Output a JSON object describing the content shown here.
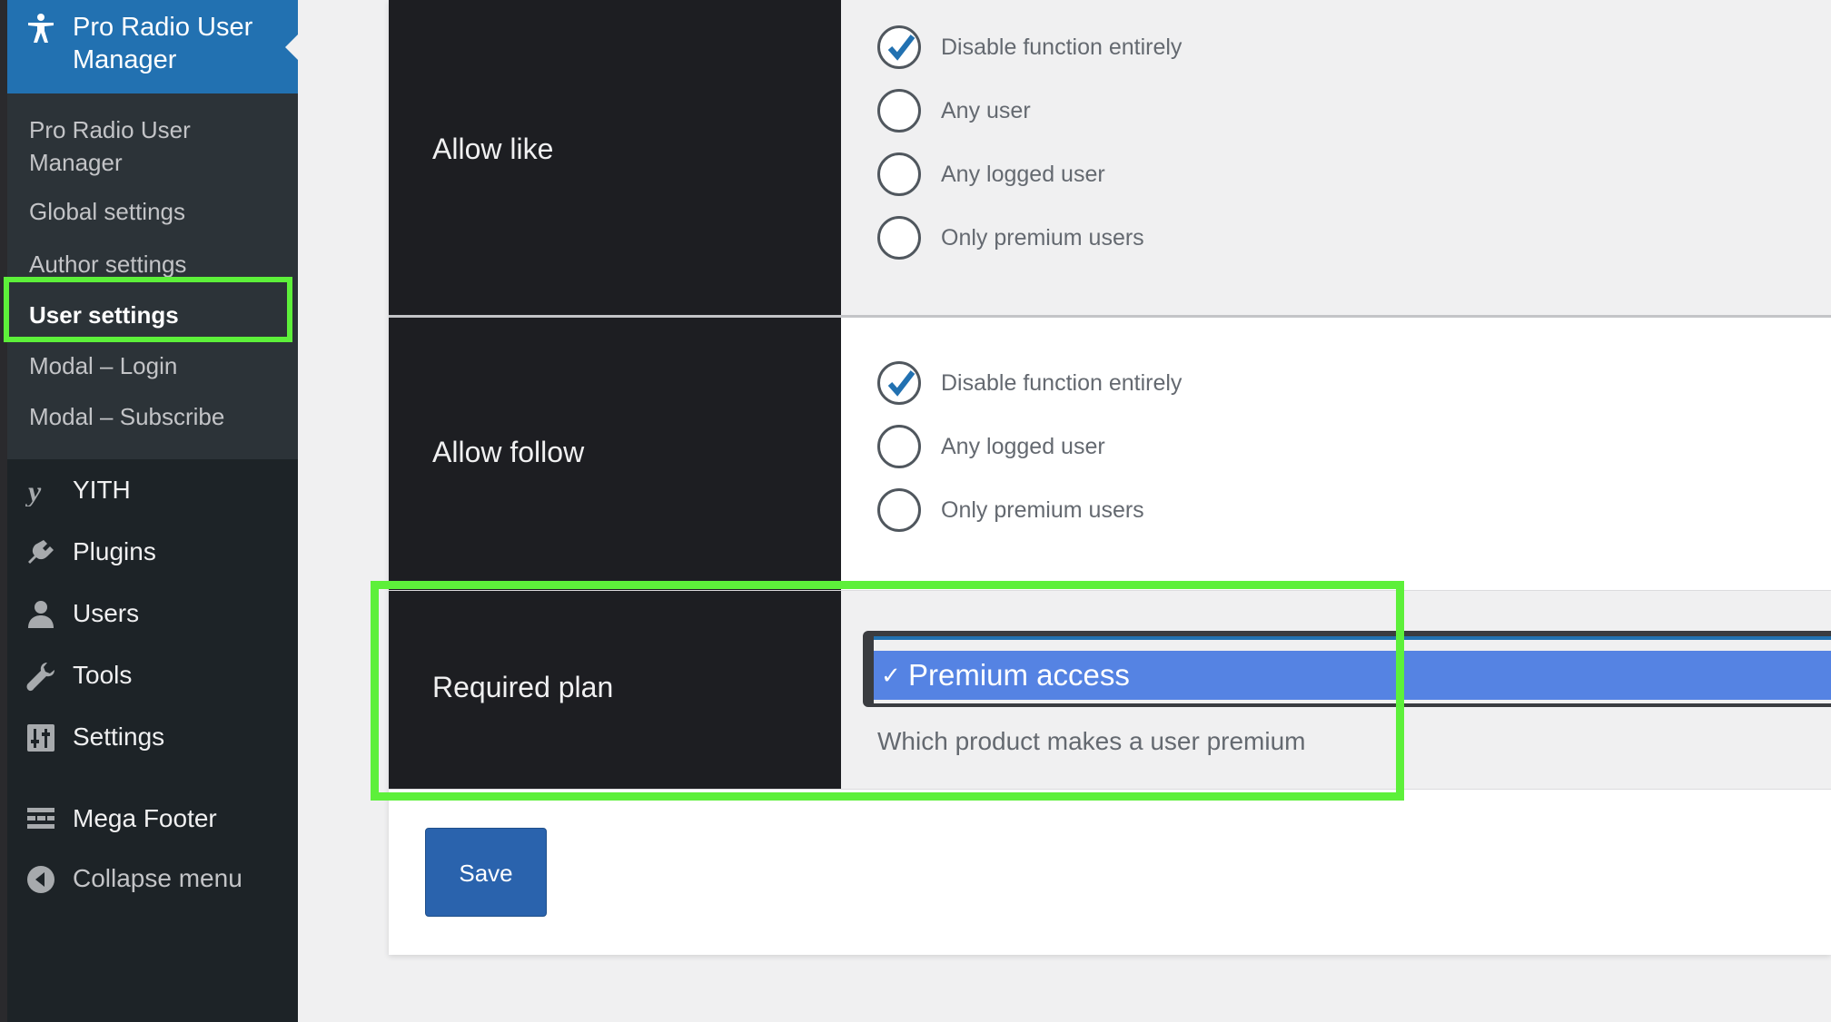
{
  "sidebar": {
    "active_title": "Pro Radio User Manager",
    "submenu": [
      {
        "label": "Pro Radio User Manager"
      },
      {
        "label": "Global settings"
      },
      {
        "label": "Author settings"
      },
      {
        "label": "User settings"
      },
      {
        "label": "Modal – Login"
      },
      {
        "label": "Modal – Subscribe"
      }
    ],
    "menu": [
      {
        "label": "YITH",
        "icon": "yith-icon"
      },
      {
        "label": "Plugins",
        "icon": "plugins-icon"
      },
      {
        "label": "Users",
        "icon": "users-icon"
      },
      {
        "label": "Tools",
        "icon": "tools-icon"
      },
      {
        "label": "Settings",
        "icon": "settings-icon"
      },
      {
        "label": "Mega Footer",
        "icon": "mega-footer-icon"
      },
      {
        "label": "Collapse menu",
        "icon": "collapse-icon"
      }
    ]
  },
  "settings": {
    "allow_like": {
      "label": "Allow like",
      "options": [
        {
          "label": "Disable function entirely",
          "checked": true
        },
        {
          "label": "Any user",
          "checked": false
        },
        {
          "label": "Any logged user",
          "checked": false
        },
        {
          "label": "Only premium users",
          "checked": false
        }
      ]
    },
    "allow_follow": {
      "label": "Allow follow",
      "options": [
        {
          "label": "Disable function entirely",
          "checked": true
        },
        {
          "label": "Any logged user",
          "checked": false
        },
        {
          "label": "Only premium users",
          "checked": false
        }
      ]
    },
    "required_plan": {
      "label": "Required plan",
      "selected": "Premium access",
      "check_mark": "✓",
      "description": "Which product makes a user premium"
    }
  },
  "save_label": "Save",
  "colors": {
    "accent": "#2271b1",
    "highlight": "#5df03a",
    "selected_option": "#5583e3",
    "save_button": "#2a63ad"
  }
}
